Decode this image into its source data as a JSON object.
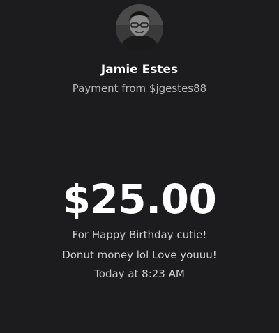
{
  "sender": {
    "avatar_icon": "user-photo-avatar",
    "name": "Jamie Estes",
    "subtitle": "Payment from $jgestes88"
  },
  "payment": {
    "amount": "$25.00",
    "note_lines": [
      "For Happy Birthday cutie!",
      "Donut money lol Love youuu!"
    ],
    "timestamp": "Today at 8:23 AM"
  },
  "colors": {
    "background": "#1c1c1e",
    "primary_text": "#ffffff",
    "secondary_text": "#b8b8bc"
  }
}
